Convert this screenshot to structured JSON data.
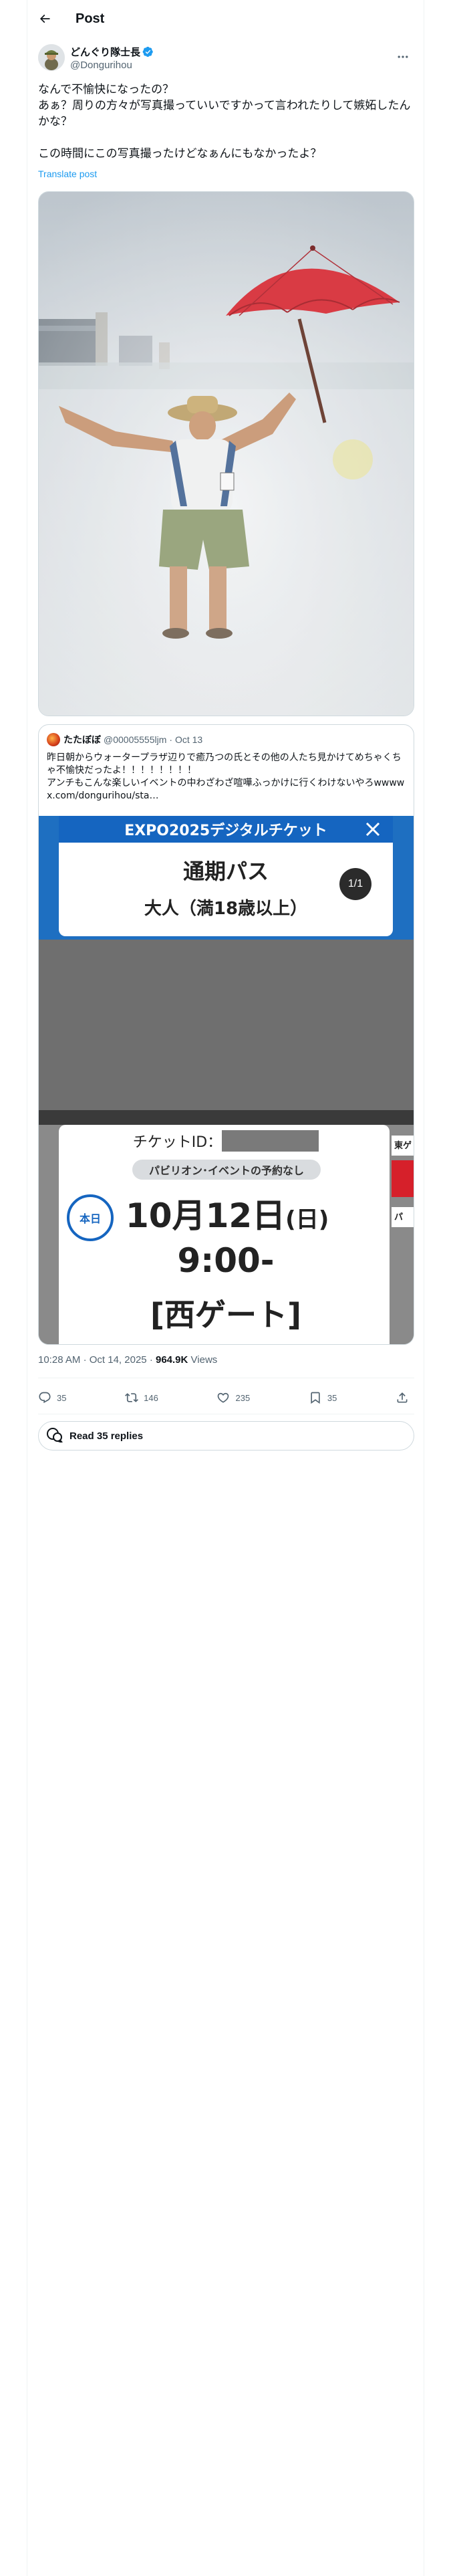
{
  "header": {
    "title": "Post"
  },
  "author": {
    "display_name": "どんぐり隊士長",
    "handle": "@Dongurihou"
  },
  "post": {
    "text": "なんで不愉快になったの？\nあぁ？周りの方々が写真撮っていいですかって言われたりして嫉妬したんかな？\n\nこの時間にこの写真撮ったけどなぁんにもなかったよ？",
    "translate_label": "Translate post"
  },
  "quote": {
    "name": "たたぼぼ",
    "handle": "@00005555ljm",
    "date": "· Oct 13",
    "text": "昨日朝からウォータープラザ辺りで癒乃つの氏とその他の人たち見かけてめちゃくちゃ不愉快だったよ！！！！！！！！\nアンチもこんな楽しいイベントの中わざわざ喧嘩ふっかけに行くわけないやろwwww x.com/dongurihou/sta…",
    "ticket": {
      "banner": "EXPO2025デジタルチケット",
      "pass_name": "通期パス",
      "category": "大人（満18歳以上）",
      "page_indicator": "1/1",
      "ticket_id_label": "チケットID：",
      "no_reservation": "パビリオン･イベントの予約なし",
      "today_badge": "本日",
      "date": "10月12日",
      "weekday": "(日)",
      "time": "9:00-",
      "gate": "[西ゲート]",
      "side_label_1": "東ゲ",
      "side_label_2": "パ"
    }
  },
  "meta": {
    "time": "10:28 AM",
    "date": "Oct 14, 2025",
    "separator": "·",
    "views_count": "964.9K",
    "views_label": "Views"
  },
  "actions": {
    "replies": "35",
    "reposts": "146",
    "likes": "235",
    "bookmarks": "35"
  },
  "read_replies_label": "Read 35 replies",
  "colors": {
    "accent": "#1d9bf0",
    "muted": "#536471",
    "expo_blue": "#1565c0",
    "umbrella_red": "#d4202b"
  }
}
